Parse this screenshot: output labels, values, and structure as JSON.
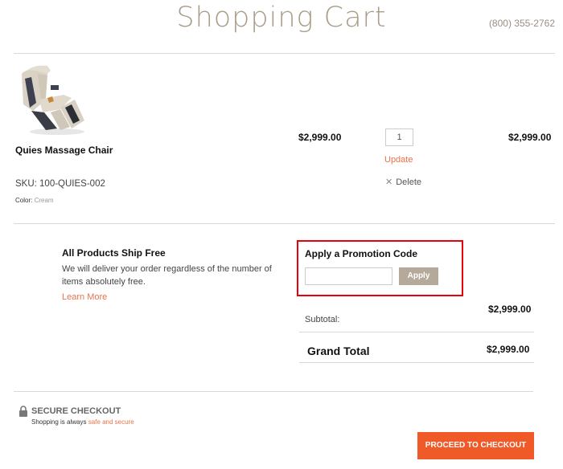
{
  "header": {
    "title": "Shopping Cart",
    "phone": "(800) 355-2762"
  },
  "cart": {
    "items": [
      {
        "name": "Quies Massage Chair",
        "sku": "SKU: 100-QUIES-002",
        "color_label": "Color:",
        "color_value": "Cream",
        "unit_price": "$2,999.00",
        "quantity": "1",
        "update_label": "Update",
        "delete_label": "Delete",
        "line_total": "$2,999.00",
        "image_icon": "massage-chair-image"
      }
    ]
  },
  "shipping": {
    "title": "All Products Ship Free",
    "text": "We will deliver your order regardless of the number of items absolutely free.",
    "learn_more": "Learn More"
  },
  "promo": {
    "title": "Apply a Promotion Code",
    "input_value": "",
    "apply_label": "Apply",
    "highlight_color": "#e8000b"
  },
  "totals": {
    "subtotal_label": "Subtotal:",
    "subtotal_value": "$2,999.00",
    "grand_label": "Grand Total",
    "grand_value": "$2,999.00"
  },
  "secure": {
    "title": "SECURE CHECKOUT",
    "text_prefix": "Shopping is always ",
    "text_link": "safe and secure",
    "icon": "lock-icon"
  },
  "checkout": {
    "button_label": "PROCEED TO CHECKOUT",
    "button_color": "#f05a28"
  },
  "colors": {
    "accent": "#e8734a",
    "title": "#a99c88"
  }
}
